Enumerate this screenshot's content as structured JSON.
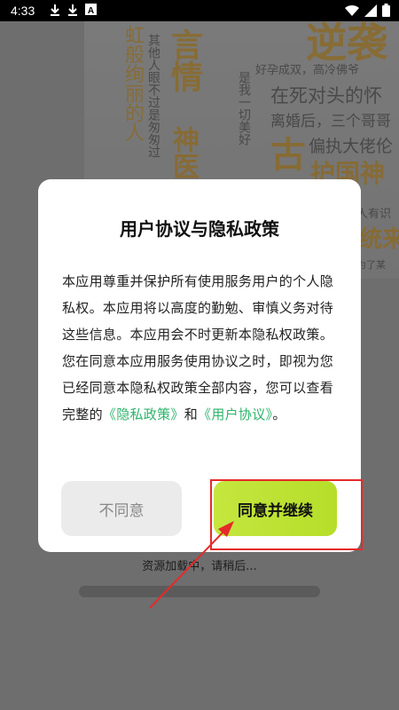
{
  "status_bar": {
    "time": "4:33",
    "notif_icons": [
      "download-icon",
      "download-icon",
      "a-icon"
    ],
    "right_icons": [
      "wifi-icon",
      "signal-icon",
      "battery-icon"
    ]
  },
  "background": {
    "poster_words": [
      "逆袭",
      "言情",
      "神医",
      "古",
      "护国神",
      "统来"
    ],
    "poster_lines": [
      "好孕成双，高冷佛爷",
      "在死对头的怀",
      "离婚后，三个哥哥",
      "偏执大佬伦",
      "人有识",
      "用有",
      "为了某"
    ],
    "poster_vertical": [
      "虹般绚丽的人",
      "其他人眼不过是匆匆过",
      "是我一切美好"
    ],
    "loading_text": "资源加载中，请稍后..."
  },
  "dialog": {
    "title": "用户协议与隐私政策",
    "body_text": "本应用尊重并保护所有使用服务用户的个人隐私权。本应用将以高度的勤勉、审慎义务对待这些信息。本应用会不时更新本隐私权政策。 您在同意本应用服务使用协议之时，即视为您已经同意本隐私权政策全部内容，您可以查看完整的",
    "privacy_link": "《隐私政策》",
    "and_text": "和",
    "agreement_link": "《用户协议》",
    "end_text": "。",
    "disagree_label": "不同意",
    "agree_label": "同意并继续"
  },
  "colors": {
    "link": "#2db36b",
    "agree_button": "#c5e63e",
    "annotation": "#e52a2a"
  }
}
